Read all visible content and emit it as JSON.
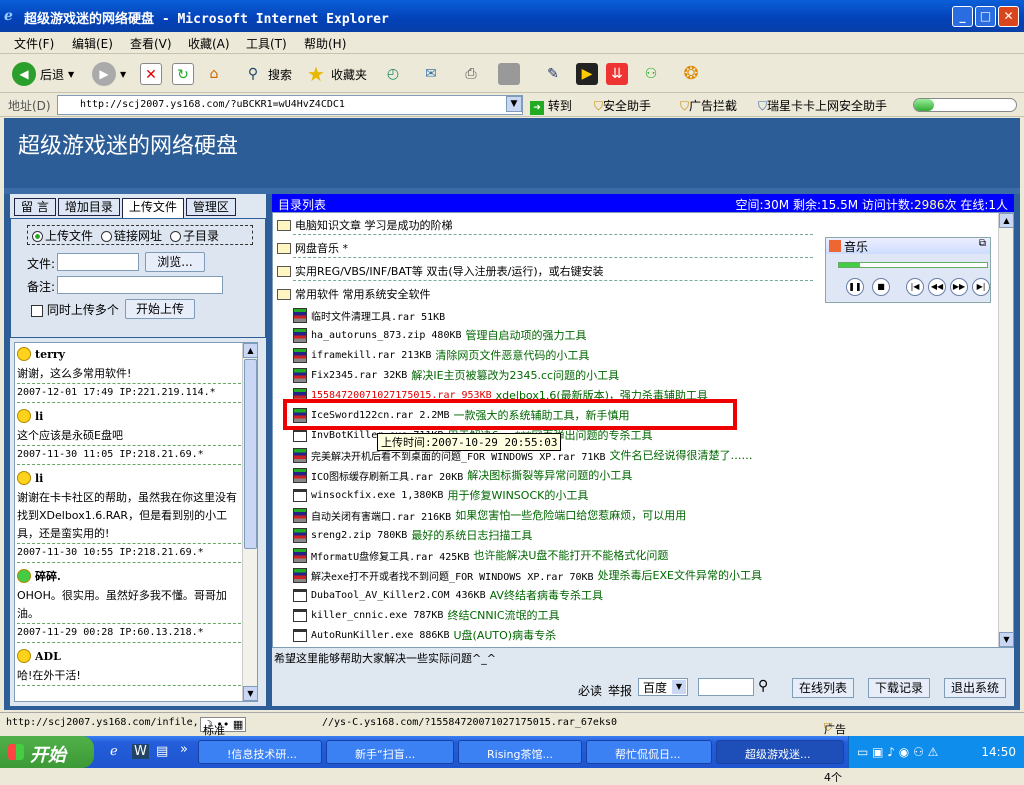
{
  "window": {
    "title": "超级游戏迷的网络硬盘 - Microsoft Internet Explorer"
  },
  "menu": [
    "文件(F)",
    "编辑(E)",
    "查看(V)",
    "收藏(A)",
    "工具(T)",
    "帮助(H)"
  ],
  "toolbar": {
    "back": "后退",
    "search": "搜索",
    "favorites": "收藏夹"
  },
  "address": {
    "label": "地址(D)",
    "url": "http://scj2007.ys168.com/?uBCKR1=wU4HvZ4CDC1",
    "go": "转到",
    "links": [
      "安全助手",
      "广告拦截",
      "瑞星卡卡上网安全助手"
    ]
  },
  "page": {
    "banner": "超级游戏迷的网络硬盘",
    "tabs": [
      "留 言",
      "增加目录",
      "上传文件",
      "管理区"
    ],
    "upload": {
      "radios": [
        "上传文件",
        "链接网址",
        "子目录"
      ],
      "file_label": "文件:",
      "browse": "浏览...",
      "note_label": "备注:",
      "checkbox": "同时上传多个",
      "submit": "开始上传"
    },
    "messages": [
      {
        "user": "terry",
        "text": "谢谢，这么多常用软件!",
        "meta": "2007-12-01 17:49 IP:221.219.114.*"
      },
      {
        "user": "li",
        "text": "这个应该是永硕E盘吧",
        "meta": "2007-11-30 11:05 IP:218.21.69.*"
      },
      {
        "user": "li",
        "text": "谢谢在卡卡社区的帮助，虽然我在你这里没有找到XDelbox1.6.RAR，但是看到别的小工具，还是蛮实用的!",
        "meta": "2007-11-30 10:55 IP:218.21.69.*"
      },
      {
        "user": "碎碎.",
        "text": "OHOH。很实用。虽然好多我不懂。哥哥加油。",
        "meta": "2007-11-29 00:28 IP:60.13.218.*"
      },
      {
        "user": "ADL",
        "text": "哈!在外干活!",
        "meta": ""
      }
    ],
    "dir": {
      "title": "目录列表",
      "space": "空间:30M 剩余:15.5M 访问计数:",
      "count": "2986",
      "space2": "次 在线:1人"
    },
    "folders": [
      "电脑知识文章 学习是成功的阶梯",
      "网盘音乐 *",
      "实用REG/VBS/INF/BAT等 双击(导入注册表/运行)，或右键安装",
      "常用软件 常用系统安全软件"
    ],
    "files": [
      {
        "name": "临时文件清理工具.rar 51KB",
        "desc": "",
        "icon": "rar"
      },
      {
        "name": "ha_autoruns_873.zip 480KB",
        "desc": "管理自启动项的强力工具",
        "icon": "rar"
      },
      {
        "name": "iframekill.rar 213KB",
        "desc": "清除网页文件恶意代码的小工具",
        "icon": "rar"
      },
      {
        "name": "Fix2345.rar 32KB",
        "desc": "解决IE主页被篡改为2345.cc问题的小工具",
        "icon": "rar"
      },
      {
        "name": "15584720071027175015.rar 953KB",
        "desc": "xdelbox1.6(最新版本)，强力杀毒辅助工具",
        "icon": "rar"
      },
      {
        "name": "IceSword122cn.rar 2.2MB",
        "desc": "一款强大的系统辅助工具，新手慎用",
        "icon": "rar"
      },
      {
        "name": "InvBotKiller.exe 711KB",
        "desc": "用于解决6.cn***网页弹出问题的专杀工具",
        "icon": "exe"
      },
      {
        "name": "完美解决开机后看不到桌面的问题_FOR WINDOWS XP.rar 71KB",
        "desc": "文件名已经说得很清楚了……",
        "icon": "rar"
      },
      {
        "name": "ICO图标缓存刷新工具.rar 20KB",
        "desc": "解决图标撕裂等异常问题的小工具",
        "icon": "rar"
      },
      {
        "name": "winsockfix.exe 1,380KB",
        "desc": "用于修复WINSOCK的小工具",
        "icon": "exe"
      },
      {
        "name": "自动关闭有害端口.rar 216KB",
        "desc": "如果您害怕一些危险端口给您惹麻烦，可以用用",
        "icon": "rar"
      },
      {
        "name": "sreng2.zip 780KB",
        "desc": "最好的系统日志扫描工具",
        "icon": "rar"
      },
      {
        "name": "MformatU盘修复工具.rar 425KB",
        "desc": "也许能解决U盘不能打开不能格式化问题",
        "icon": "rar"
      },
      {
        "name": "解决exe打不开或者找不到问题_FOR WINDOWS XP.rar 70KB",
        "desc": "处理杀毒后EXE文件异常的小工具",
        "icon": "rar"
      },
      {
        "name": "DubaTool_AV_Killer2.COM 436KB",
        "desc": "AV终结者病毒专杀工具",
        "icon": "exe"
      },
      {
        "name": "killer_cnnic.exe 787KB",
        "desc": "终结CNNIC流氓的工具",
        "icon": "exe"
      },
      {
        "name": "AutoRunKiller.exe 886KB",
        "desc": "U盘(AUTO)病毒专杀",
        "icon": "exe"
      }
    ],
    "tooltip": "上传时间:2007-10-29 20:55:03",
    "player": {
      "title": "音乐"
    },
    "footer": {
      "note": "希望这里能够帮助大家解决一些实际问题^_^",
      "must": "必读",
      "report": "举报",
      "engine": "百度",
      "btn1": "在线列表",
      "btn2": "下载记录",
      "btn3": "退出系统"
    }
  },
  "statusbar": {
    "url": "http://scj2007.ys168.com/infile,",
    "ime": "标准",
    "url2": "//ys-C.ys168.com/?15584720071027175015.rar_67eks0",
    "adblock": "广告拦截：4个"
  },
  "taskbar": {
    "start": "开始",
    "items": [
      "!信息技术研...",
      "新手“扫盲...",
      "Rising茶馆...",
      "帮忙侃侃日...",
      "超级游戏迷..."
    ],
    "clock": "14:50"
  }
}
